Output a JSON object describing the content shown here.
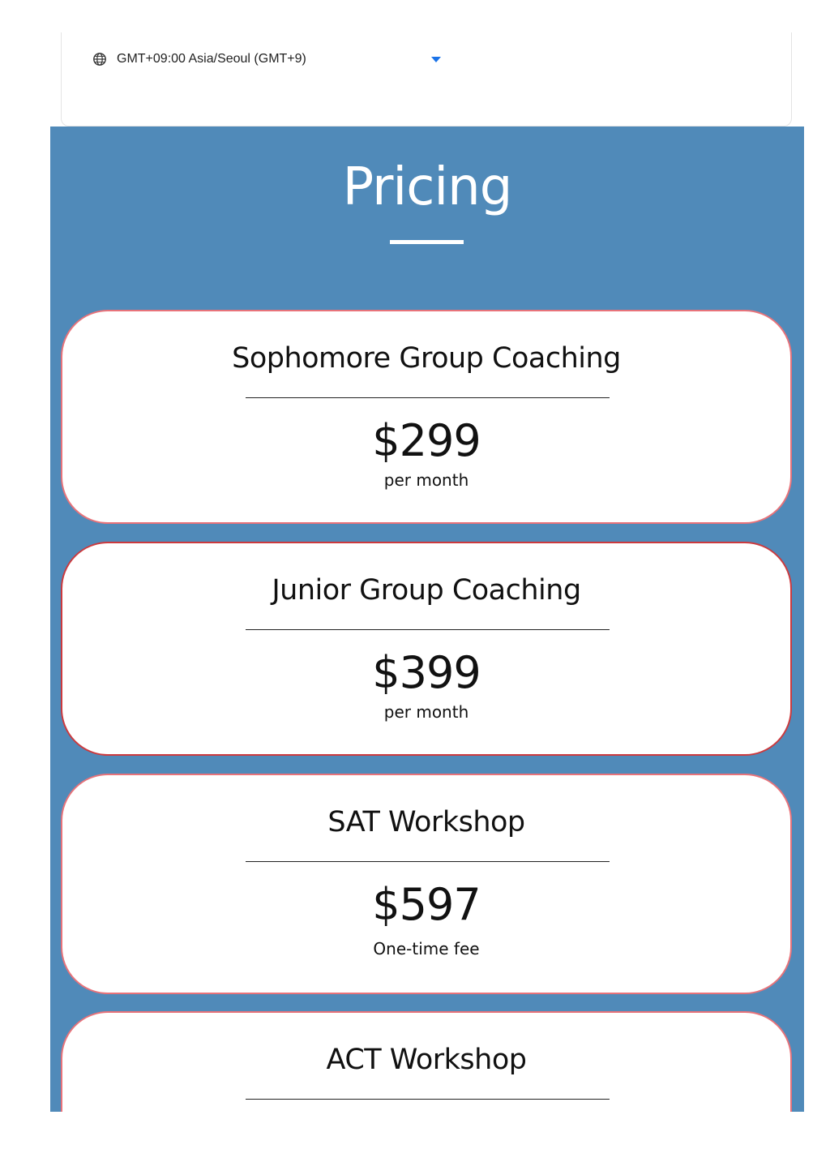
{
  "timezone": {
    "icon": "globe-icon",
    "value": "GMT+09:00 Asia/Seoul (GMT+9)",
    "dropdown_icon": "caret-down-icon",
    "accent_color": "#1a73e8"
  },
  "pricing": {
    "title": "Pricing",
    "background_color": "#508ab9",
    "card_border_color": "#e8737a",
    "plans": [
      {
        "name": "Sophomore Group Coaching",
        "price": "$299",
        "period": "per month"
      },
      {
        "name": "Junior Group Coaching",
        "price": "$399",
        "period": "per month"
      },
      {
        "name": "SAT Workshop",
        "price": "$597",
        "period": "One-time fee"
      },
      {
        "name": "ACT Workshop",
        "price": "",
        "period": ""
      }
    ]
  }
}
